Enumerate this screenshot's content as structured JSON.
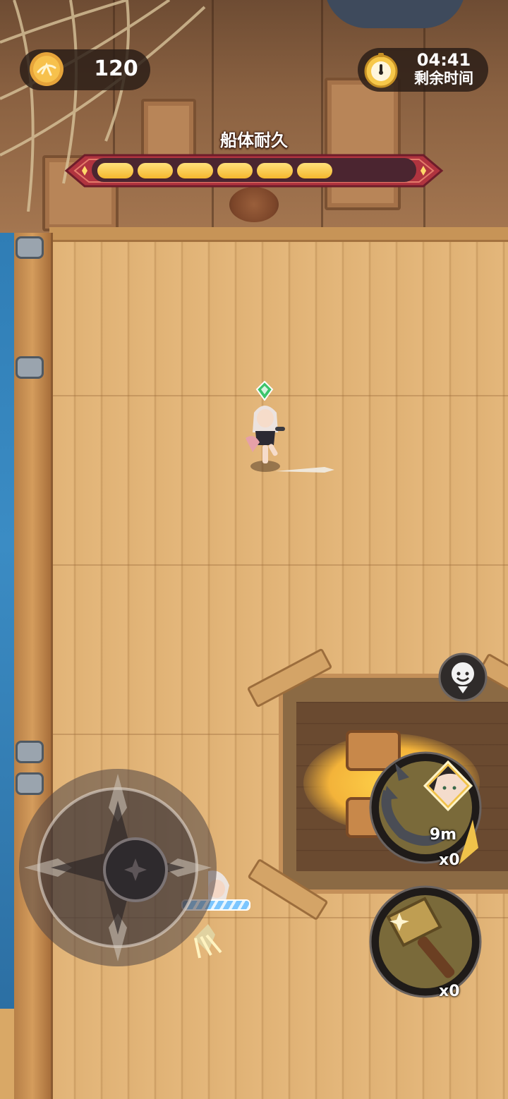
{
  "hud": {
    "coins": "120",
    "timer": {
      "time": "04:41",
      "label": "剩余时间"
    },
    "hull": {
      "title": "船体耐久",
      "segments_filled": 6,
      "segments_total": 8
    }
  },
  "skills": {
    "grapple": {
      "icon": "grapple-hook-icon",
      "distance": "9m",
      "count": "x0"
    },
    "hammer": {
      "icon": "hammer-icon",
      "count": "x0"
    }
  },
  "buttons": {
    "emote_icon": "smiley-chat-icon",
    "joystick_icon": "compass-joystick-icon"
  },
  "colors": {
    "hud_pill": "#281c16",
    "hull_bar_frame": "#b0343f",
    "hull_segment": "#f5b82e",
    "deck": "#e0b275",
    "water": "#2f7db5"
  }
}
